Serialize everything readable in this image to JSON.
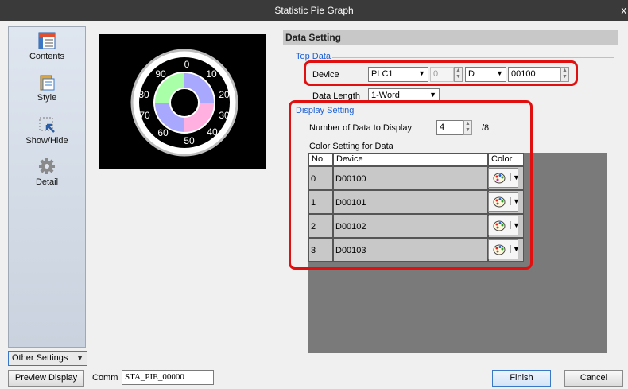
{
  "window": {
    "title": "Statistic Pie Graph",
    "close_glyph": "x"
  },
  "sidebar": {
    "items": [
      {
        "label": "Contents",
        "icon": "contents-icon"
      },
      {
        "label": "Style",
        "icon": "style-icon"
      },
      {
        "label": "Show/Hide",
        "icon": "show-hide-icon"
      },
      {
        "label": "Detail",
        "icon": "gear-icon"
      }
    ],
    "other_settings_label": "Other Settings"
  },
  "preview": {
    "gauge_labels": [
      "0",
      "10",
      "20",
      "30",
      "40",
      "50",
      "60",
      "70",
      "80",
      "90"
    ],
    "segment_colors": [
      "#a8a8ff",
      "#ffb0e0",
      "#a8a8ff",
      "#a8ffa8"
    ]
  },
  "data_setting": {
    "header": "Data Setting",
    "top_data": {
      "group_label": "Top Data",
      "device_label": "Device",
      "plc_value": "PLC1",
      "station_value": "0",
      "device_type_value": "D",
      "address_value": "00100",
      "data_length_label": "Data Length",
      "data_length_value": "1-Word"
    },
    "display_setting": {
      "group_label": "Display Setting",
      "num_data_label": "Number of Data to Display",
      "num_data_value": "4",
      "num_data_max": "/8",
      "color_setting_label": "Color Setting for Data",
      "table": {
        "headers": [
          "No.",
          "Device",
          "Color"
        ],
        "rows": [
          {
            "no": "0",
            "device": "D00100"
          },
          {
            "no": "1",
            "device": "D00101"
          },
          {
            "no": "2",
            "device": "D00102"
          },
          {
            "no": "3",
            "device": "D00103"
          }
        ]
      }
    }
  },
  "bottom": {
    "preview_display_label": "Preview Display",
    "comm_label": "Comm",
    "comm_value": "STA_PIE_00000",
    "finish_label": "Finish",
    "cancel_label": "Cancel"
  },
  "colors": {
    "highlight": "#e01010",
    "group_label": "#1a5fd6",
    "title_bar": "#3a3a3a"
  }
}
